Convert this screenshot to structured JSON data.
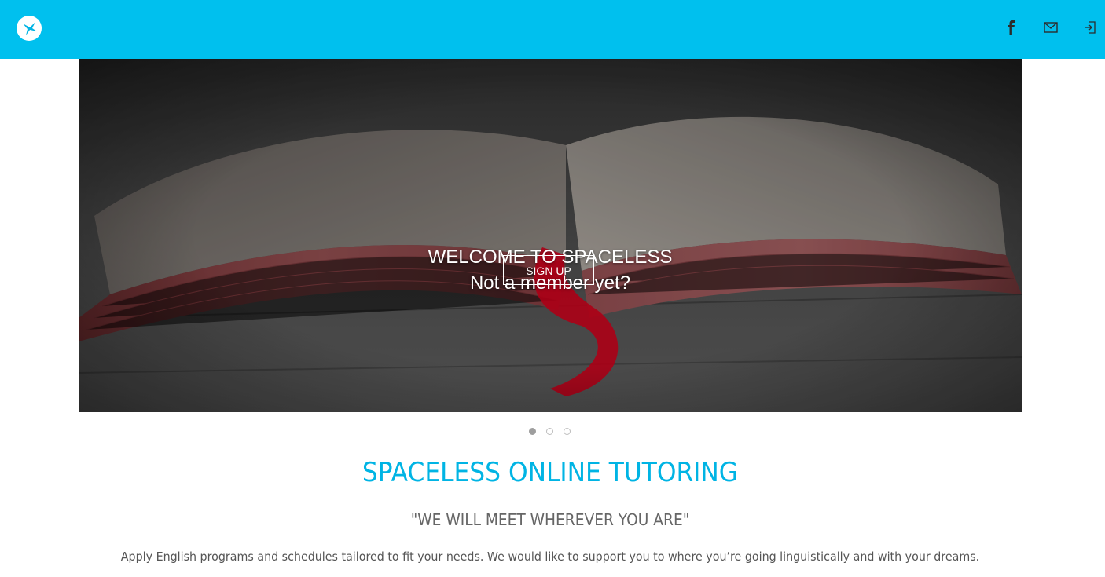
{
  "header": {
    "logo_icon": "hummingbird-logo-icon",
    "brand_color": "#00c0ee",
    "nav_icons": [
      "facebook-icon",
      "mail-icon",
      "login-icon"
    ]
  },
  "hero": {
    "title_line1": "WELCOME TO SPACELESS",
    "title_line2": "Not a member yet?",
    "signup_label": "SIGN UP",
    "carousel_slides": 3,
    "active_slide": 1
  },
  "main": {
    "section_title": "SPACELESS ONLINE TUTORING",
    "tagline": "\"WE WILL MEET WHEREVER YOU ARE\"",
    "description": "Apply English programs and schedules tailored to fit your needs. We would like to support you to where you’re going linguistically and with your dreams.",
    "accent_color": "#00b4e4"
  }
}
